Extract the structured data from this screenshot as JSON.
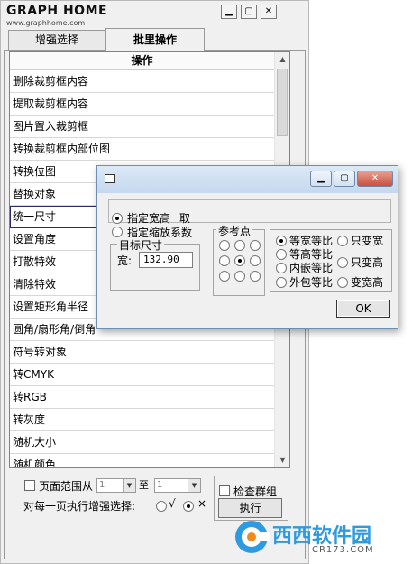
{
  "brand": {
    "name": "GRAPH HOME",
    "url": "www.graphhome.com"
  },
  "window_buttons": {
    "minimize": "▁",
    "restore": "▢",
    "close": "✕"
  },
  "tabs": [
    {
      "label": "增强选择"
    },
    {
      "label": "批里操作"
    }
  ],
  "list": {
    "header": "操作",
    "items": [
      "删除裁剪框内容",
      "提取裁剪框内容",
      "图片置入裁剪框",
      "转换裁剪框内部位图",
      "转换位图",
      "替换对象",
      "统一尺寸",
      "设置角度",
      "打散特效",
      "清除特效",
      "设置矩形角半径",
      "圆角/扇形角/倒角",
      "符号转对象",
      "转CMYK",
      "转RGB",
      "转灰度",
      "随机大小",
      "随机颜色"
    ]
  },
  "bottom": {
    "page_range_label": "页面范围从",
    "from_value": "1",
    "to_label": "至",
    "to_value": "1",
    "check_group_label": "检查群组",
    "apply_each_label": "对每一页执行增强选择:",
    "yes_mark": "√",
    "no_mark": "×",
    "execute_label": "执行"
  },
  "dialog": {
    "window_buttons": {
      "minimize": "▁",
      "restore": "▢",
      "close": "✕"
    },
    "opt_size": "指定宽高",
    "take_label": "取",
    "opt_scale": "指定缩放系数",
    "target_size_label": "目标尺寸",
    "width_label": "宽:",
    "width_value": "132.90",
    "ref_point_label": "参考点",
    "ratio_options": {
      "equal_wh": "等宽等比",
      "only_w": "只变宽",
      "equal_h": "等高等比",
      "only_h": "只变高",
      "inner": "内嵌等比",
      "outer": "外包等比",
      "change_wh": "变宽高"
    },
    "ok_label": "OK"
  },
  "watermark": {
    "text": "西西软件园",
    "sub": "CR173.COM"
  }
}
